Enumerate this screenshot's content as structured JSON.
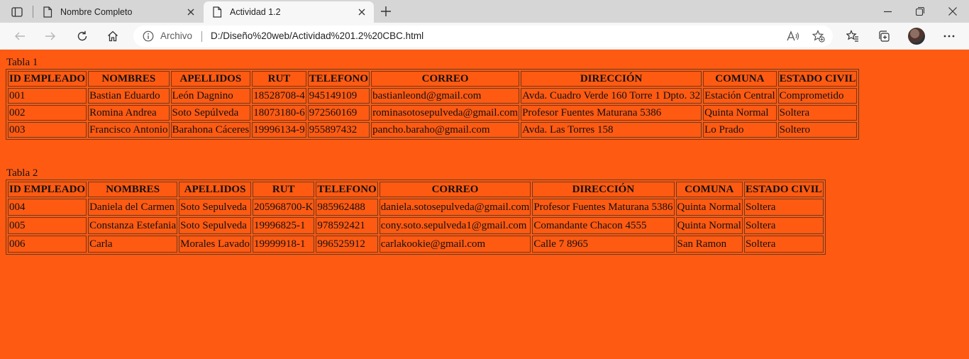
{
  "browser": {
    "tabs": [
      {
        "title": "Nombre Completo",
        "active": false
      },
      {
        "title": "Actividad 1.2",
        "active": true
      }
    ],
    "address": {
      "scheme_label": "Archivo",
      "url": "D:/Diseño%20web/Actividad%201.2%20CBC.html"
    }
  },
  "page": {
    "tables": [
      {
        "caption": "Tabla 1",
        "headers": [
          "ID EMPLEADO",
          "NOMBRES",
          "APELLIDOS",
          "RUT",
          "TELEFONO",
          "CORREO",
          "DIRECCIÓN",
          "COMUNA",
          "ESTADO CIVIL"
        ],
        "rows": [
          [
            "001",
            "Bastian Eduardo",
            "León Dagnino",
            "18528708-4",
            "945149109",
            "bastianleond@gmail.com",
            "Avda. Cuadro Verde 160 Torre 1 Dpto. 32",
            "Estación Central",
            "Comprometido"
          ],
          [
            "002",
            "Romina Andrea",
            "Soto Sepúlveda",
            "18073180-6",
            "972560169",
            "rominasotosepulveda@gmail.com",
            "Profesor Fuentes Maturana 5386",
            "Quinta Normal",
            "Soltera"
          ],
          [
            "003",
            "Francisco Antonio",
            "Barahona Cáceres",
            "19996134-9",
            "955897432",
            "pancho.baraho@gmail.com",
            "Avda. Las Torres 158",
            "Lo Prado",
            "Soltero"
          ]
        ]
      },
      {
        "caption": "Tabla 2",
        "headers": [
          "ID EMPLEADO",
          "NOMBRES",
          "APELLIDOS",
          "RUT",
          "TELEFONO",
          "CORREO",
          "DIRECCIÓN",
          "COMUNA",
          "ESTADO CIVIL"
        ],
        "rows": [
          [
            "004",
            "Daniela del Carmen",
            "Soto Sepulveda",
            "205968700-K",
            "985962488",
            "daniela.sotosepulveda@gmail.com",
            "Profesor Fuentes Maturana 5386",
            "Quinta Normal",
            "Soltera"
          ],
          [
            "005",
            "Constanza Estefania",
            "Soto Sepulveda",
            "19996825-1",
            "978592421",
            "cony.soto.sepulveda1@gmail.com",
            "Comandante Chacon 4555",
            "Quinta Normal",
            "Soltera"
          ],
          [
            "006",
            "Carla",
            "Morales Lavado",
            "19999918-1",
            "996525912",
            "carlakookie@gmail.com",
            "Calle 7 8965",
            "San Ramon",
            "Soltera"
          ]
        ]
      }
    ]
  },
  "colors": {
    "page_background": "#ff5a12",
    "tabstrip": "#d6d6d6",
    "toolbar": "#f7f7f7",
    "table_border": "#6b3a1f"
  }
}
